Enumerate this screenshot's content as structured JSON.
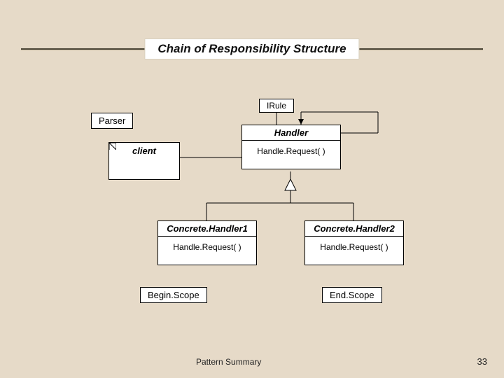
{
  "title": "Chain of Responsibility Structure",
  "labels": {
    "parser": "Parser",
    "irule": "IRule",
    "begin_scope": "Begin.Scope",
    "end_scope": "End.Scope"
  },
  "client": {
    "name": "client"
  },
  "handler": {
    "name": "Handler",
    "op": "Handle.Request( )"
  },
  "ch1": {
    "name": "Concrete.Handler1",
    "op": "Handle.Request( )"
  },
  "ch2": {
    "name": "Concrete.Handler2",
    "op": "Handle.Request( )"
  },
  "footer": {
    "caption": "Pattern Summary",
    "page": "33"
  }
}
